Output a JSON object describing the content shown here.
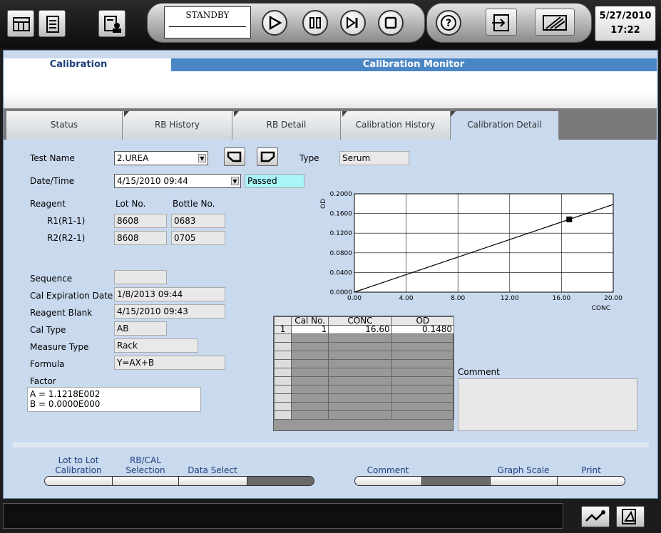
{
  "toolbar": {
    "status_text": "STANDBY",
    "date": "5/27/2010",
    "time": "17:22"
  },
  "header": {
    "section": "Calibration",
    "title": "Calibration Monitor"
  },
  "tabs": [
    "Status",
    "RB History",
    "RB Detail",
    "Calibration History",
    "Calibration Detail"
  ],
  "form": {
    "test_name_label": "Test Name",
    "test_name_value": "2.UREA",
    "type_label": "Type",
    "type_value": "Serum",
    "datetime_label": "Date/Time",
    "datetime_value": "4/15/2010 09:44",
    "result_value": "Passed",
    "reagent_label": "Reagent",
    "lot_label": "Lot No.",
    "bottle_label": "Bottle No.",
    "reagents": [
      {
        "name": "R1(R1-1)",
        "lot": "8608",
        "bottle": "0683"
      },
      {
        "name": "R2(R2-1)",
        "lot": "8608",
        "bottle": "0705"
      }
    ],
    "sequence_label": "Sequence",
    "sequence_value": "",
    "cal_exp_label": "Cal Expiration Date",
    "cal_exp_value": "1/8/2013 09:44",
    "reagent_blank_label": "Reagent Blank",
    "reagent_blank_value": "4/15/2010 09:43",
    "cal_type_label": "Cal Type",
    "cal_type_value": "AB",
    "measure_type_label": "Measure Type",
    "measure_type_value": "Rack",
    "formula_label": "Formula",
    "formula_value": "Y=AX+B",
    "factor_label": "Factor",
    "factor_a": "A = 1.1218E002",
    "factor_b": "B = 0.0000E000"
  },
  "chart_data": {
    "type": "line",
    "xlabel": "CONC",
    "ylabel": "OD",
    "xlim": [
      0,
      20
    ],
    "ylim": [
      0,
      0.2
    ],
    "x_ticks": [
      "0.00",
      "4.00",
      "8.00",
      "12.00",
      "16.00",
      "20.00"
    ],
    "y_ticks": [
      "0.0000",
      "0.0400",
      "0.0800",
      "0.1200",
      "0.1600",
      "0.2000"
    ],
    "line": {
      "x": [
        0,
        20
      ],
      "y": [
        0,
        0.1783
      ]
    },
    "points": [
      {
        "x": 16.6,
        "y": 0.148
      }
    ],
    "grid": true
  },
  "table": {
    "headers": [
      "Cal No.",
      "CONC",
      "OD"
    ],
    "rows": [
      {
        "idx": "1",
        "cal_no": "1",
        "conc": "16.60",
        "od": "0.1480"
      }
    ]
  },
  "comment_label": "Comment",
  "comment_value": "",
  "bottom": {
    "lot_to_lot_1": "Lot to Lot",
    "lot_to_lot_2": "Calibration",
    "rbcal_1": "RB/CAL",
    "rbcal_2": "Selection",
    "data_select": "Data Select",
    "comment": "Comment",
    "graph_scale": "Graph Scale",
    "print": "Print"
  },
  "colors": {
    "header": "#4a86c4",
    "panel": "#c9d9ee",
    "passed": "#a8f4f8"
  }
}
